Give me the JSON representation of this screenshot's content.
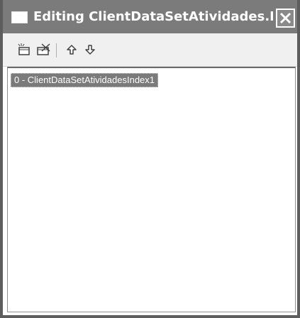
{
  "window": {
    "title": "Editing ClientDataSetAtividades.I..."
  },
  "toolbar": {
    "buttons": [
      {
        "icon": "add-new-icon"
      },
      {
        "icon": "delete-icon"
      },
      {
        "icon": "arrow-up-icon"
      },
      {
        "icon": "arrow-down-icon"
      }
    ]
  },
  "list": {
    "items": [
      {
        "label": "0 - ClientDataSetAtividadesIndex1"
      }
    ]
  },
  "colors": {
    "titlebar": "#7b7b7b",
    "selection": "#7a7a7a",
    "frame": "#5d5d5d"
  }
}
